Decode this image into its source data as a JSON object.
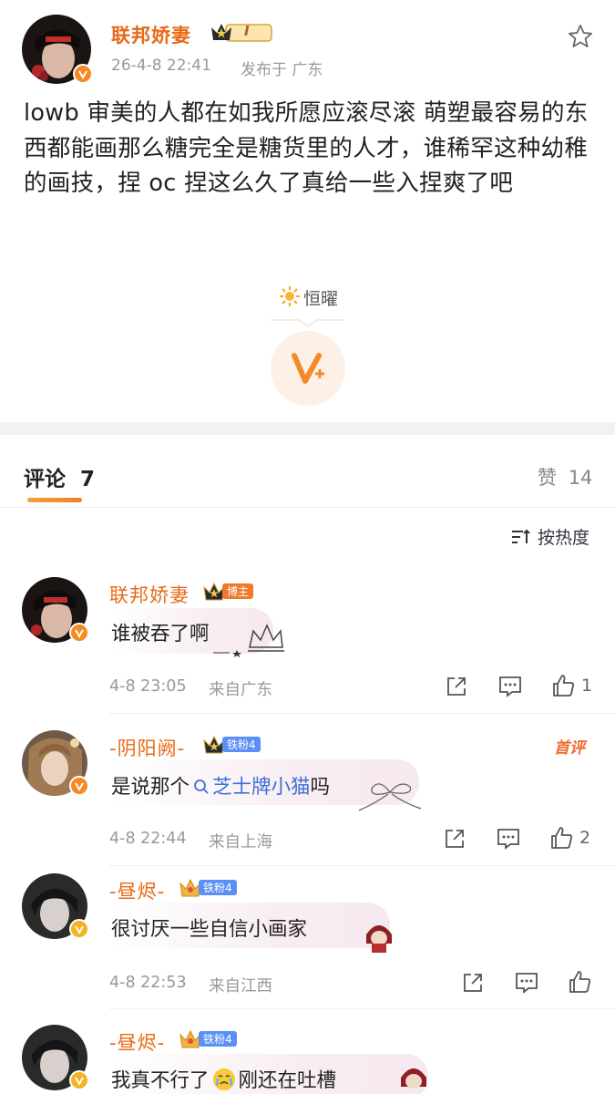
{
  "post": {
    "author": "联邦娇妻",
    "level_badge": "I",
    "datetime": "26-4-8 22:41",
    "posted_from": "发布于 广东",
    "text": "lowb 审美的人都在如我所愿应滚尽滚 萌塑最容易的东西都能画那么糖完全是糖货里的人才，谁稀罕这种幼稚的画技，捏 oc 捏这么久了真给一些入捏爽了吧",
    "weather_label": "恒曜",
    "star_icon": "star-outline-icon",
    "weibo_v_icon": "v-plus-icon"
  },
  "comments_header": {
    "title": "评论",
    "count": "7",
    "likes_label": "赞",
    "likes_count": "14",
    "sort_label": "按热度"
  },
  "comments": [
    {
      "author": "联邦娇妻",
      "badge": "博主",
      "text": "谁被吞了啊",
      "datetime": "4-8 23:05",
      "location": "来自广东",
      "likes": "1"
    },
    {
      "author": "-阴阳阙-",
      "badge": "铁粉4",
      "top_label": "首评",
      "text_before": "是说那个",
      "link_text": "芝士牌小猫",
      "text_after": "吗",
      "datetime": "4-8 22:44",
      "location": "来自上海",
      "likes": "2"
    },
    {
      "author": "-昼烬-",
      "badge": "铁粉4",
      "text": "很讨厌一些自信小画家",
      "datetime": "4-8 22:53",
      "location": "来自江西",
      "likes": ""
    },
    {
      "author": "-昼烬-",
      "badge": "铁粉4",
      "text_before": "我真不行了",
      "text_after": "刚还在吐槽"
    }
  ],
  "colors": {
    "name_orange": "#e86b1a",
    "v_badge": "#f6891f",
    "fan_badge": "#5b8ff6",
    "blogger_badge": "#f07a2b",
    "link_blue": "#3c6fd6"
  }
}
